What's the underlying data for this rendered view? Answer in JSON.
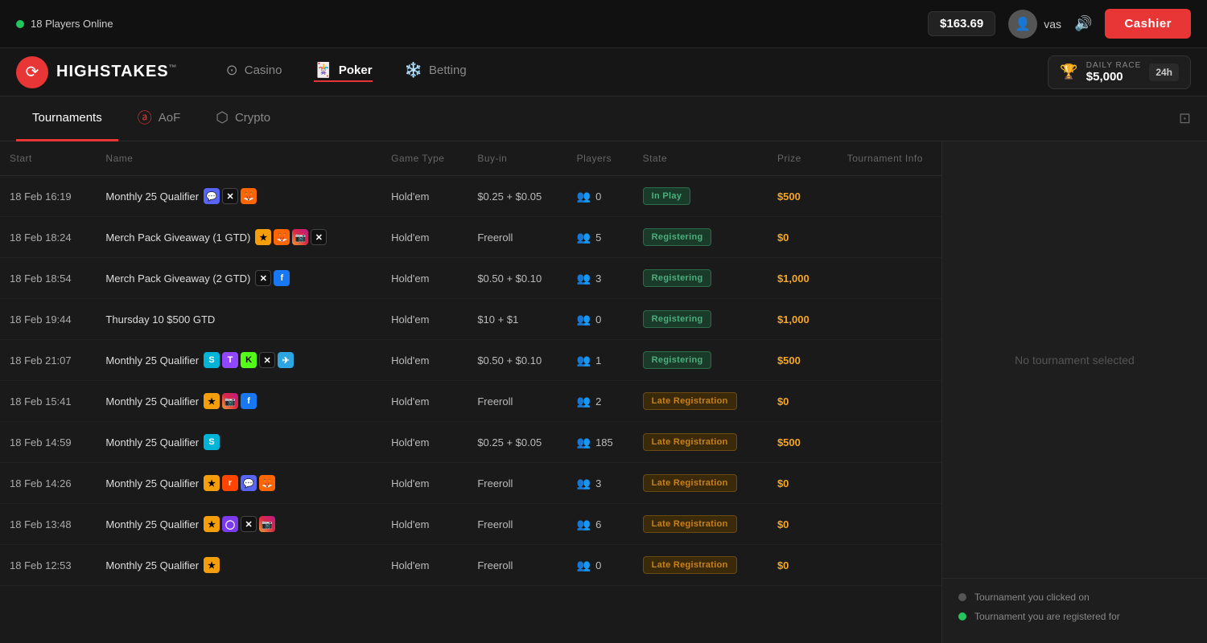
{
  "topbar": {
    "online_indicator": "18 Players Online",
    "balance": "$163.69",
    "username": "vas",
    "cashier_label": "Cashier"
  },
  "navbar": {
    "logo_text_light": "HIGH",
    "logo_text_bold": "STAKES",
    "logo_tm": "™",
    "nav_items": [
      {
        "label": "Casino",
        "icon": "🎰",
        "active": false
      },
      {
        "label": "Poker",
        "icon": "🃏",
        "active": true
      },
      {
        "label": "Betting",
        "icon": "⚙️",
        "active": false
      }
    ],
    "daily_race_label": "DAILY RACE",
    "daily_race_amount": "$5,000",
    "daily_race_timer": "24h"
  },
  "tabs": {
    "items": [
      {
        "label": "Tournaments",
        "active": true
      },
      {
        "label": "AoF",
        "active": false
      },
      {
        "label": "Crypto",
        "active": false
      }
    ]
  },
  "table": {
    "columns": [
      "Start",
      "Name",
      "Game Type",
      "Buy-in",
      "Players",
      "State",
      "Prize",
      "Tournament Info"
    ],
    "rows": [
      {
        "start": "18 Feb 16:19",
        "name": "Monthly 25 Qualifier",
        "socials": [
          "discord",
          "x",
          "fox"
        ],
        "game_type": "Hold'em",
        "buyin": "$0.25 + $0.05",
        "players": "0",
        "state": "In Play",
        "state_type": "inplay",
        "prize": "$500"
      },
      {
        "start": "18 Feb 18:24",
        "name": "Merch Pack Giveaway (1 GTD)",
        "socials": [
          "star",
          "fox",
          "insta",
          "x"
        ],
        "game_type": "Hold'em",
        "buyin": "Freeroll",
        "players": "5",
        "state": "Registering",
        "state_type": "registering",
        "prize": "$0"
      },
      {
        "start": "18 Feb 18:54",
        "name": "Merch Pack Giveaway (2 GTD)",
        "socials": [
          "x",
          "fb"
        ],
        "game_type": "Hold'em",
        "buyin": "$0.50 + $0.10",
        "players": "3",
        "state": "Registering",
        "state_type": "registering",
        "prize": "$1,000"
      },
      {
        "start": "18 Feb 19:44",
        "name": "Thursday 10 $500 GTD",
        "socials": [],
        "game_type": "Hold'em",
        "buyin": "$10 + $1",
        "players": "0",
        "state": "Registering",
        "state_type": "registering",
        "prize": "$1,000"
      },
      {
        "start": "18 Feb 21:07",
        "name": "Monthly 25 Qualifier",
        "socials": [
          "s",
          "twitch",
          "kick",
          "x",
          "tg"
        ],
        "game_type": "Hold'em",
        "buyin": "$0.50 + $0.10",
        "players": "1",
        "state": "Registering",
        "state_type": "registering",
        "prize": "$500"
      },
      {
        "start": "18 Feb 15:41",
        "name": "Monthly 25 Qualifier",
        "socials": [
          "star",
          "insta",
          "fb"
        ],
        "game_type": "Hold'em",
        "buyin": "Freeroll",
        "players": "2",
        "state": "Late Registration",
        "state_type": "late",
        "prize": "$0"
      },
      {
        "start": "18 Feb 14:59",
        "name": "Monthly 25 Qualifier",
        "socials": [
          "s"
        ],
        "game_type": "Hold'em",
        "buyin": "$0.25 + $0.05",
        "players": "185",
        "state": "Late Registration",
        "state_type": "late",
        "prize": "$500"
      },
      {
        "start": "18 Feb 14:26",
        "name": "Monthly 25 Qualifier",
        "socials": [
          "star",
          "reddit",
          "discord",
          "fox"
        ],
        "game_type": "Hold'em",
        "buyin": "Freeroll",
        "players": "3",
        "state": "Late Registration",
        "state_type": "late",
        "prize": "$0"
      },
      {
        "start": "18 Feb 13:48",
        "name": "Monthly 25 Qualifier",
        "socials": [
          "star",
          "circle",
          "x",
          "insta"
        ],
        "game_type": "Hold'em",
        "buyin": "Freeroll",
        "players": "6",
        "state": "Late Registration",
        "state_type": "late",
        "prize": "$0"
      },
      {
        "start": "18 Feb 12:53",
        "name": "Monthly 25 Qualifier",
        "socials": [
          "star"
        ],
        "game_type": "Hold'em",
        "buyin": "Freeroll",
        "players": "0",
        "state": "Late Registration",
        "state_type": "late",
        "prize": "$0"
      }
    ]
  },
  "panel": {
    "empty_text": "No tournament selected",
    "legend": [
      {
        "label": "Tournament you clicked on",
        "dot": "gray"
      },
      {
        "label": "Tournament you are registered for",
        "dot": "green"
      }
    ]
  }
}
